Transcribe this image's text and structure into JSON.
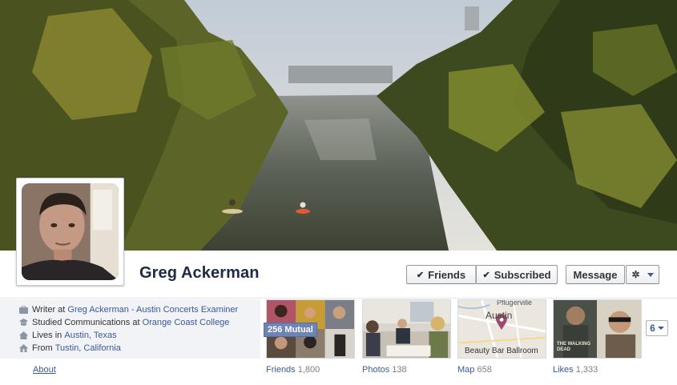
{
  "profile": {
    "name": "Greg Ackerman"
  },
  "actions": {
    "friends_label": "Friends",
    "subscribed_label": "Subscribed",
    "message_label": "Message",
    "gear_icon": "gear-icon"
  },
  "info": {
    "work_prefix": "Writer at",
    "work_link": "Greg Ackerman - Austin Concerts Examiner",
    "study_prefix": "Studied Communications at",
    "study_link": "Orange Coast College",
    "lives_prefix": "Lives in",
    "lives_link": "Austin, Texas",
    "from_prefix": "From",
    "from_link": "Tustin, California"
  },
  "nav": {
    "about_label": "About"
  },
  "apps": {
    "friends": {
      "label": "Friends",
      "count": "1,800",
      "badge": "256 Mutual"
    },
    "photos": {
      "label": "Photos",
      "count": "138"
    },
    "map": {
      "label": "Map",
      "count": "658",
      "caption": "Beauty Bar Ballroom",
      "city_top": "Pflugerville",
      "city_main": "Austin"
    },
    "likes": {
      "label": "Likes",
      "count": "1,333",
      "poster_text": "THE WALKING DEAD"
    }
  },
  "more": {
    "count": "6"
  },
  "colors": {
    "link": "#3b5998",
    "name": "#1d2a44",
    "info_bg": "#f1f3f7",
    "badge_bg": "#6d84b4"
  }
}
